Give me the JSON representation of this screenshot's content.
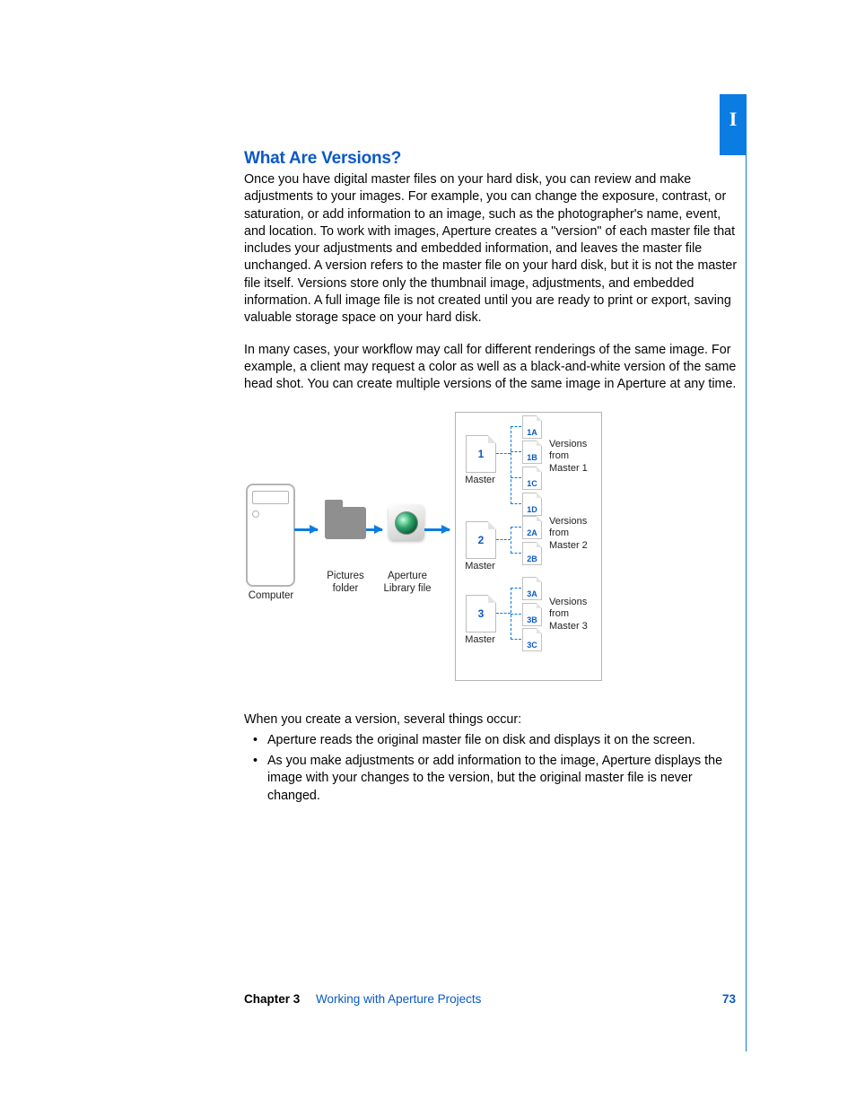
{
  "tab": "I",
  "heading": "What Are Versions?",
  "para1": "Once you have digital master files on your hard disk, you can review and make adjustments to your images. For example, you can change the exposure, contrast, or saturation, or add information to an image, such as the photographer's name, event, and location. To work with images, Aperture creates a \"version\" of each master file that includes your adjustments and embedded information, and leaves the master file unchanged. A version refers to the master file on your hard disk, but it is not the master file itself. Versions store only the thumbnail image, adjustments, and embedded information. A full image file is not created until you are ready to print or export, saving valuable storage space on your hard disk.",
  "para2": "In many cases, your workflow may call for different renderings of the same image. For example, a client may request a color as well as a black-and-white version of the same head shot. You can create multiple versions of the same image in Aperture at any time.",
  "para3": "When you create a version, several things occur:",
  "bullet1": "Aperture reads the original master file on disk and displays it on the screen.",
  "bullet2": "As you make adjustments or add information to the image, Aperture displays the image with your changes to the version, but the original master file is never changed.",
  "diagram": {
    "computer": "Computer",
    "pictures_line1": "Pictures",
    "pictures_line2": "folder",
    "aperture_line1": "Aperture",
    "aperture_line2": "Library file",
    "master_label": "Master",
    "masters": {
      "m1": "1",
      "m2": "2",
      "m3": "3"
    },
    "versions1": [
      "1A",
      "1B",
      "1C",
      "1D"
    ],
    "versions2": [
      "2A",
      "2B"
    ],
    "versions3": [
      "3A",
      "3B",
      "3C"
    ],
    "vlabel1a": "Versions",
    "vlabel1b": "from",
    "vlabel1c": "Master 1",
    "vlabel2a": "Versions",
    "vlabel2b": "from",
    "vlabel2c": "Master 2",
    "vlabel3a": "Versions",
    "vlabel3b": "from",
    "vlabel3c": "Master 3"
  },
  "footer": {
    "chapter": "Chapter 3",
    "title": "Working with Aperture Projects",
    "page": "73"
  }
}
